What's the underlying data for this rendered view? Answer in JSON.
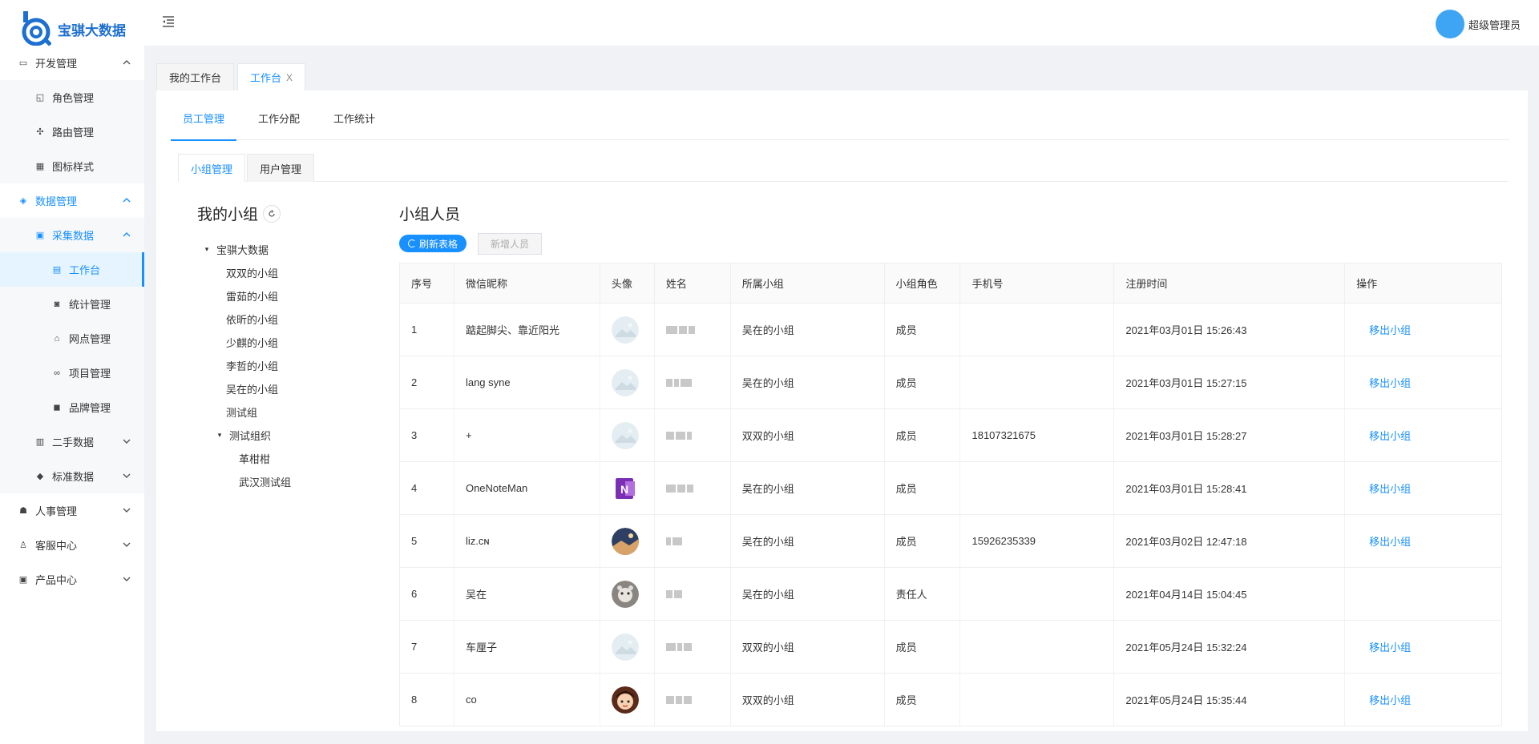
{
  "brand": {
    "name": "宝骐大数据"
  },
  "user": {
    "name": "超级管理员"
  },
  "sidebar": {
    "items": [
      {
        "label": "开发管理",
        "level": 1,
        "icon": "monitor-icon",
        "expanded": true
      },
      {
        "label": "角色管理",
        "level": 2,
        "icon": "role-icon"
      },
      {
        "label": "路由管理",
        "level": 2,
        "icon": "route-icon"
      },
      {
        "label": "图标样式",
        "level": 2,
        "icon": "grid-icon"
      },
      {
        "label": "数据管理",
        "level": 1,
        "icon": "layers-icon",
        "expanded": true
      },
      {
        "label": "采集数据",
        "level": 2,
        "icon": "collect-icon",
        "expanded": true
      },
      {
        "label": "工作台",
        "level": 3,
        "icon": "desk-icon",
        "active": true
      },
      {
        "label": "统计管理",
        "level": 3,
        "icon": "stats-icon"
      },
      {
        "label": "网点管理",
        "level": 3,
        "icon": "shop-icon"
      },
      {
        "label": "项目管理",
        "level": 3,
        "icon": "link-icon"
      },
      {
        "label": "品牌管理",
        "level": 3,
        "icon": "brand-icon"
      },
      {
        "label": "二手数据",
        "level": 2,
        "icon": "doc-icon",
        "expanded": false
      },
      {
        "label": "标准数据",
        "level": 2,
        "icon": "diamond-icon",
        "expanded": false
      },
      {
        "label": "人事管理",
        "level": 1,
        "icon": "people-icon",
        "expanded": false
      },
      {
        "label": "客服中心",
        "level": 1,
        "icon": "person-icon",
        "expanded": false
      },
      {
        "label": "产品中心",
        "level": 1,
        "icon": "box-icon",
        "expanded": false
      }
    ]
  },
  "page_tabs": [
    {
      "label": "我的工作台"
    },
    {
      "label": "工作台",
      "close": "X",
      "active": true
    }
  ],
  "main_tabs": [
    {
      "label": "员工管理",
      "active": true
    },
    {
      "label": "工作分配"
    },
    {
      "label": "工作统计"
    }
  ],
  "sub_tabs": [
    {
      "label": "小组管理",
      "active": true
    },
    {
      "label": "用户管理"
    }
  ],
  "groups": {
    "title": "我的小组",
    "tree": [
      {
        "label": "宝骐大数据",
        "depth": 0,
        "caret": "▾"
      },
      {
        "label": "双双的小组",
        "depth": 1
      },
      {
        "label": "雷茹的小组",
        "depth": 1
      },
      {
        "label": "依昕的小组",
        "depth": 1
      },
      {
        "label": "少麒的小组",
        "depth": 1
      },
      {
        "label": "李哲的小组",
        "depth": 1
      },
      {
        "label": "吴在的小组",
        "depth": 1
      },
      {
        "label": "测试组",
        "depth": 1
      },
      {
        "label": "测试组织",
        "depth": 1,
        "caret": "▾"
      },
      {
        "label": "革柑柑",
        "depth": 2
      },
      {
        "label": "武汉测试组",
        "depth": 2
      }
    ]
  },
  "members": {
    "title": "小组人员",
    "refresh_label": "刷新表格",
    "add_label": "新增人员",
    "columns": [
      "序号",
      "微信昵称",
      "头像",
      "姓名",
      "所属小组",
      "小组角色",
      "手机号",
      "注册时间",
      "操作"
    ],
    "rows": [
      {
        "no": "1",
        "nick": "踮起脚尖、靠近阳光",
        "avatar": "placeholder",
        "group": "吴在的小组",
        "role": "成员",
        "phone": "",
        "time": "2021年03月01日 15:26:43",
        "action": "移出小组"
      },
      {
        "no": "2",
        "nick": "lang syne",
        "avatar": "placeholder",
        "group": "吴在的小组",
        "role": "成员",
        "phone": "",
        "time": "2021年03月01日 15:27:15",
        "action": "移出小组"
      },
      {
        "no": "3",
        "nick": "+",
        "avatar": "placeholder",
        "group": "双双的小组",
        "role": "成员",
        "phone": "18107321675",
        "time": "2021年03月01日 15:28:27",
        "action": "移出小组"
      },
      {
        "no": "4",
        "nick": "OneNoteMan",
        "avatar": "onenote",
        "group": "吴在的小组",
        "role": "成员",
        "phone": "",
        "time": "2021年03月01日 15:28:41",
        "action": "移出小组"
      },
      {
        "no": "5",
        "nick": "liz.ᴄɴ",
        "avatar": "landscape",
        "group": "吴在的小组",
        "role": "成员",
        "phone": "15926235339",
        "time": "2021年03月02日 12:47:18",
        "action": "移出小组"
      },
      {
        "no": "6",
        "nick": "吴在",
        "avatar": "animal",
        "group": "吴在的小组",
        "role": "责任人",
        "phone": "",
        "time": "2021年04月14日 15:04:45",
        "action": ""
      },
      {
        "no": "7",
        "nick": "车厘子",
        "avatar": "placeholder",
        "group": "双双的小组",
        "role": "成员",
        "phone": "",
        "time": "2021年05月24日 15:32:24",
        "action": "移出小组"
      },
      {
        "no": "8",
        "nick": "co",
        "avatar": "cartoon",
        "group": "双双的小组",
        "role": "成员",
        "phone": "",
        "time": "2021年05月24日 15:35:44",
        "action": "移出小组"
      }
    ]
  },
  "colors": {
    "primary": "#1890ff",
    "brand": "#1d6fd1",
    "avatar_bg": "#3da5f4"
  }
}
